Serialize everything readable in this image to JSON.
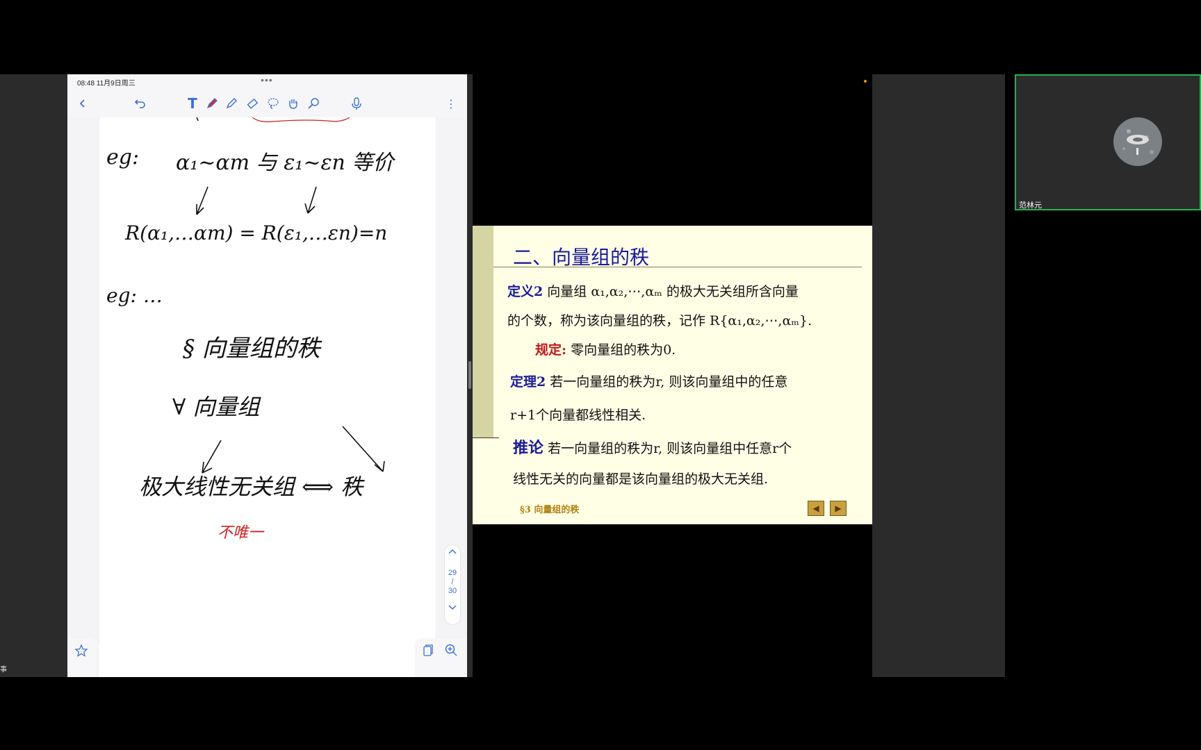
{
  "notes_app": {
    "status_time": "08:48   11月9日周三",
    "status_dots": "•••",
    "page_indicator": {
      "current": "29",
      "sep": "/",
      "total": "30"
    },
    "handwriting": {
      "line1_prefix": "eg:",
      "line1": "α₁~αm 与 ε₁~εn 等价",
      "line2": "R(α₁,…αm) = R(ε₁,…εn)=n",
      "line3": "eg:  …",
      "line4": "§ 向量组的秩",
      "line5": "∀ 向量组",
      "line6": "极大线性无关组 ⟺ 秩",
      "line7": "不唯一"
    },
    "colors": {
      "accent": "#3a6fd8",
      "ink": "#111111",
      "red_ink": "#d02020"
    }
  },
  "slide": {
    "heading": "二、向量组的秩",
    "def_label": "定义2",
    "def_text_1": "向量组 α₁,α₂,⋯,αₘ 的极大无关组所含向量",
    "def_text_2": "的个数，称为该向量组的秩，记作 R{α₁,α₂,⋯,αₘ}.",
    "rule_label": "规定:",
    "rule_text": "零向量组的秩为0.",
    "thm_label": "定理2",
    "thm_text_1": "若一向量组的秩为r, 则该向量组中的任意",
    "thm_text_2": "r+1个向量都线性相关.",
    "cor_label": "推论",
    "cor_text_1": "若一向量组的秩为r, 则该向量组中任意r个",
    "cor_text_2": "线性无关的向量都是该向量组的极大无关组.",
    "footer": "§3  向量组的秩",
    "prev": "◀",
    "next": "▶"
  },
  "webcam": {
    "name": "范林元"
  },
  "left_edge_text": "事"
}
